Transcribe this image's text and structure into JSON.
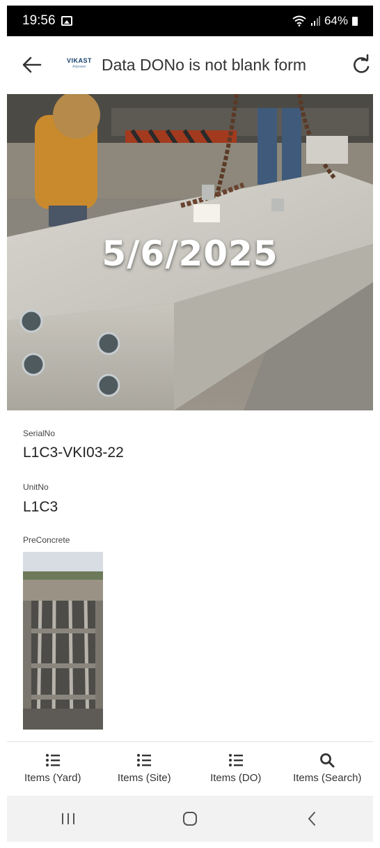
{
  "status_bar": {
    "time": "19:56",
    "battery": "64%",
    "icons": [
      "gallery-icon",
      "wifi-icon",
      "signal-icon",
      "battery-icon"
    ]
  },
  "app_bar": {
    "title": "Data DONo is not blank form",
    "logo_text": "VIKAST",
    "logo_sub": "Airpower",
    "icons": [
      "arrow-left-icon",
      "refresh-icon"
    ]
  },
  "photo": {
    "date_overlay": "5/6/2025"
  },
  "fields": {
    "serial_label": "SerialNo",
    "serial_value": "L1C3-VKI03-22",
    "unit_label": "UnitNo",
    "unit_value": "L1C3",
    "preconcrete_label": "PreConcrete"
  },
  "bottom_nav": {
    "items": [
      {
        "label": "Items (Yard)",
        "icon": "list-icon"
      },
      {
        "label": "Items (Site)",
        "icon": "list-icon"
      },
      {
        "label": "Items (DO)",
        "icon": "list-icon"
      },
      {
        "label": "Items (Search)",
        "icon": "search-icon"
      }
    ]
  },
  "colors": {
    "accent": "#333333",
    "status_bar_bg": "#000000",
    "system_nav_bg": "#f2f2f2"
  }
}
